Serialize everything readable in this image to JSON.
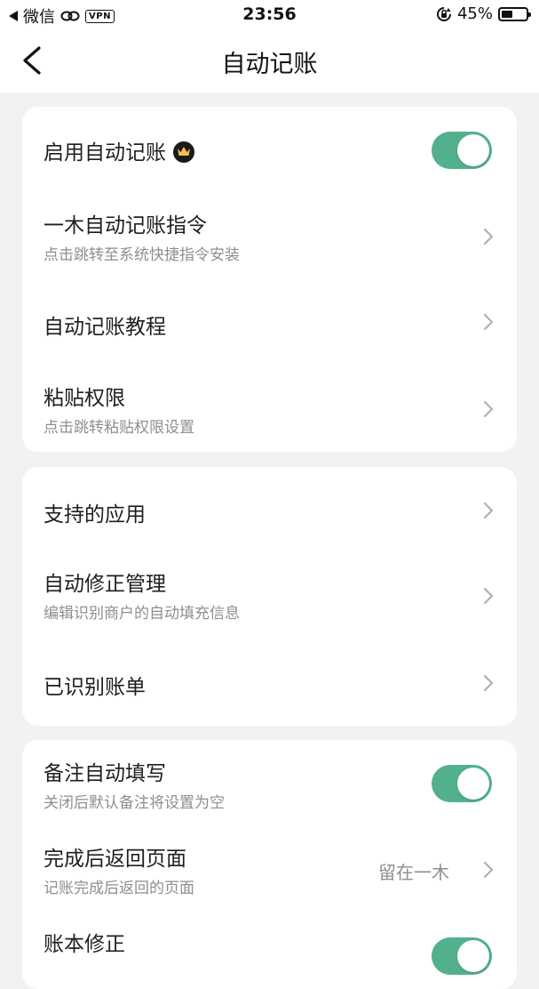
{
  "status_bar": {
    "carrier": "微信",
    "vpn": "VPN",
    "time": "23:56",
    "battery_pct": "45%",
    "battery_level": 0.45
  },
  "nav": {
    "title": "自动记账"
  },
  "card1": {
    "enable": {
      "title": "启用自动记账",
      "on": true
    },
    "shortcut": {
      "title": "一木自动记账指令",
      "sub": "点击跳转至系统快捷指令安装"
    },
    "tutorial": {
      "title": "自动记账教程"
    },
    "paste": {
      "title": "粘贴权限",
      "sub": "点击跳转粘贴权限设置"
    }
  },
  "card2": {
    "apps": {
      "title": "支持的应用"
    },
    "correction": {
      "title": "自动修正管理",
      "sub": "编辑识别商户的自动填充信息"
    },
    "recognized": {
      "title": "已识别账单"
    }
  },
  "card3": {
    "note_fill": {
      "title": "备注自动填写",
      "sub": "关闭后默认备注将设置为空",
      "on": true
    },
    "return_page": {
      "title": "完成后返回页面",
      "sub": "记账完成后返回的页面",
      "value": "留在一木"
    },
    "ledger_fix": {
      "title": "账本修正",
      "on": true
    }
  },
  "colors": {
    "toggle_on": "#52b08d",
    "background": "#f2f2f4",
    "card": "#ffffff"
  }
}
